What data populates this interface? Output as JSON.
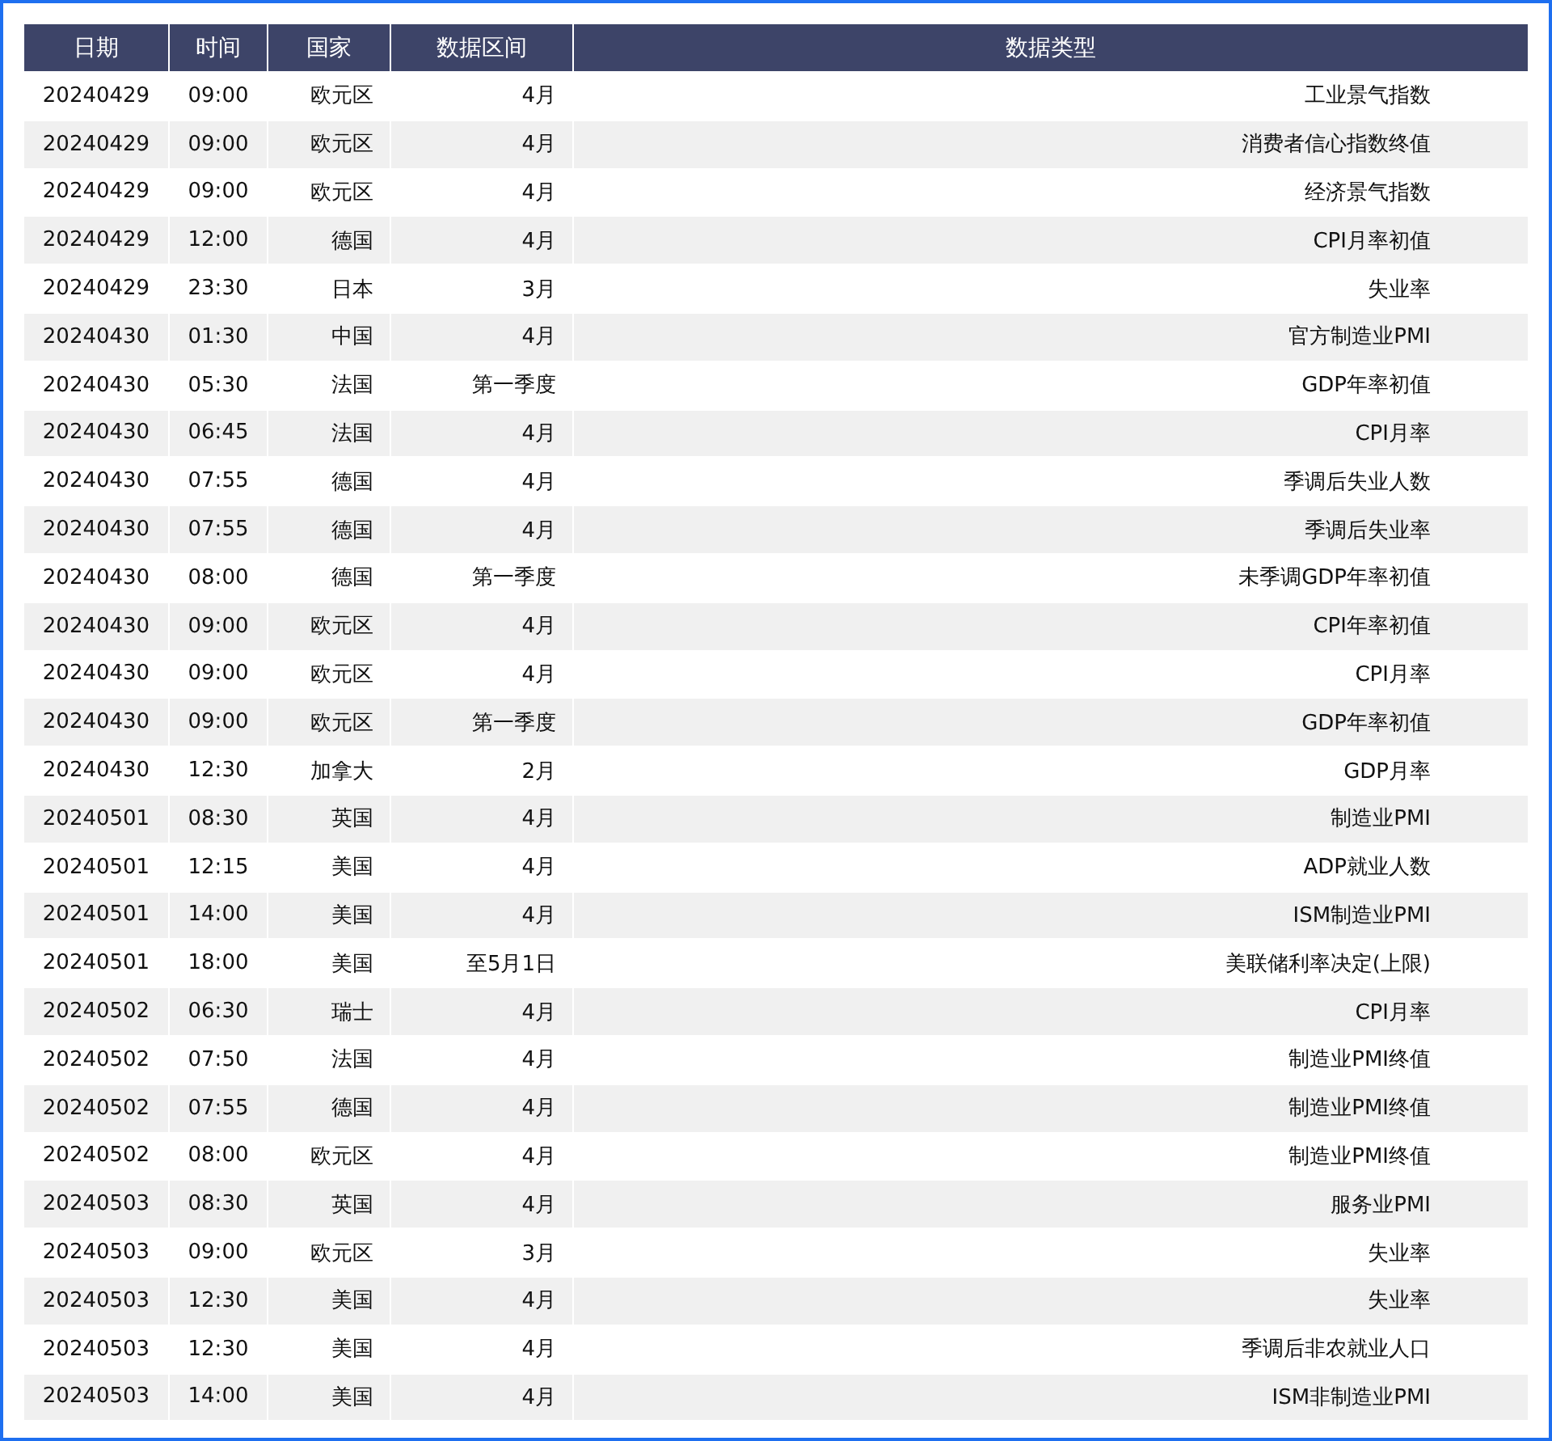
{
  "table": {
    "columns": [
      "日期",
      "时间",
      "国家",
      "数据区间",
      "数据类型"
    ],
    "rows": [
      [
        "20240429",
        "09:00",
        "欧元区",
        "4月",
        "工业景气指数"
      ],
      [
        "20240429",
        "09:00",
        "欧元区",
        "4月",
        "消费者信心指数终值"
      ],
      [
        "20240429",
        "09:00",
        "欧元区",
        "4月",
        "经济景气指数"
      ],
      [
        "20240429",
        "12:00",
        "德国",
        "4月",
        "CPI月率初值"
      ],
      [
        "20240429",
        "23:30",
        "日本",
        "3月",
        "失业率"
      ],
      [
        "20240430",
        "01:30",
        "中国",
        "4月",
        "官方制造业PMI"
      ],
      [
        "20240430",
        "05:30",
        "法国",
        "第一季度",
        "GDP年率初值"
      ],
      [
        "20240430",
        "06:45",
        "法国",
        "4月",
        "CPI月率"
      ],
      [
        "20240430",
        "07:55",
        "德国",
        "4月",
        "季调后失业人数"
      ],
      [
        "20240430",
        "07:55",
        "德国",
        "4月",
        "季调后失业率"
      ],
      [
        "20240430",
        "08:00",
        "德国",
        "第一季度",
        "未季调GDP年率初值"
      ],
      [
        "20240430",
        "09:00",
        "欧元区",
        "4月",
        "CPI年率初值"
      ],
      [
        "20240430",
        "09:00",
        "欧元区",
        "4月",
        "CPI月率"
      ],
      [
        "20240430",
        "09:00",
        "欧元区",
        "第一季度",
        "GDP年率初值"
      ],
      [
        "20240430",
        "12:30",
        "加拿大",
        "2月",
        "GDP月率"
      ],
      [
        "20240501",
        "08:30",
        "英国",
        "4月",
        "制造业PMI"
      ],
      [
        "20240501",
        "12:15",
        "美国",
        "4月",
        "ADP就业人数"
      ],
      [
        "20240501",
        "14:00",
        "美国",
        "4月",
        "ISM制造业PMI"
      ],
      [
        "20240501",
        "18:00",
        "美国",
        "至5月1日",
        "美联储利率决定(上限)"
      ],
      [
        "20240502",
        "06:30",
        "瑞士",
        "4月",
        "CPI月率"
      ],
      [
        "20240502",
        "07:50",
        "法国",
        "4月",
        "制造业PMI终值"
      ],
      [
        "20240502",
        "07:55",
        "德国",
        "4月",
        "制造业PMI终值"
      ],
      [
        "20240502",
        "08:00",
        "欧元区",
        "4月",
        "制造业PMI终值"
      ],
      [
        "20240503",
        "08:30",
        "英国",
        "4月",
        "服务业PMI"
      ],
      [
        "20240503",
        "09:00",
        "欧元区",
        "3月",
        "失业率"
      ],
      [
        "20240503",
        "12:30",
        "美国",
        "4月",
        "失业率"
      ],
      [
        "20240503",
        "12:30",
        "美国",
        "4月",
        "季调后非农就业人口"
      ],
      [
        "20240503",
        "14:00",
        "美国",
        "4月",
        "ISM非制造业PMI"
      ]
    ]
  }
}
